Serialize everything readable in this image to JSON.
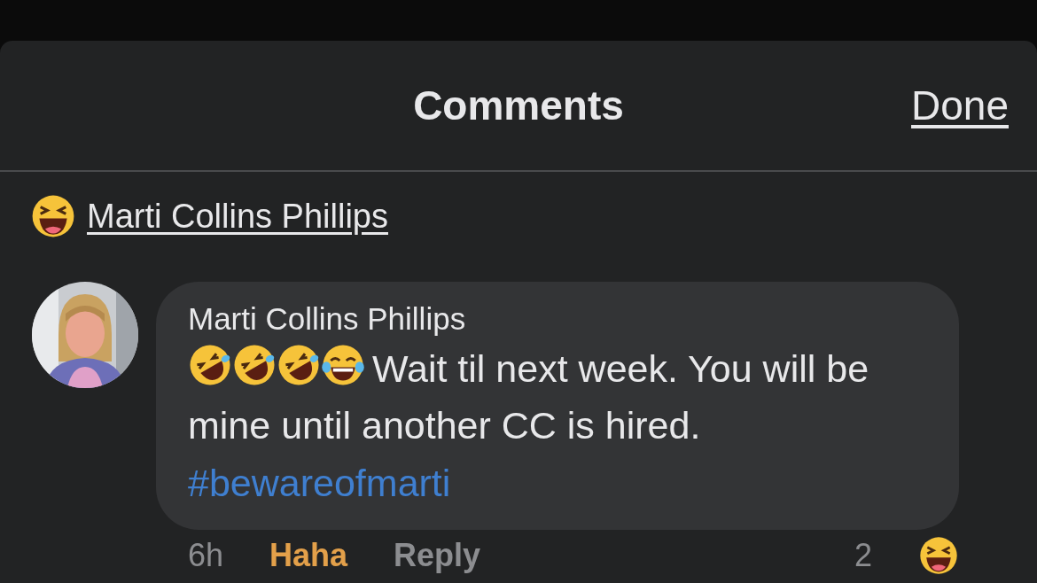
{
  "sheet": {
    "title": "Comments",
    "done_label": "Done"
  },
  "reactor": {
    "reaction": {
      "kind": "haha"
    },
    "name": "Marti Collins Phillips"
  },
  "comment": {
    "author": "Marti Collins Phillips",
    "emojis": [
      {
        "kind": "rofl"
      },
      {
        "kind": "rofl"
      },
      {
        "kind": "rofl"
      },
      {
        "kind": "joy"
      }
    ],
    "text": "Wait til next week. You will be mine until another CC is hired.",
    "hashtag": "#bewareofmarti",
    "time": "6h",
    "reaction_label": "Haha",
    "reacted": true,
    "reply_label": "Reply",
    "reaction_count": "2",
    "count_reaction": {
      "kind": "haha"
    }
  }
}
